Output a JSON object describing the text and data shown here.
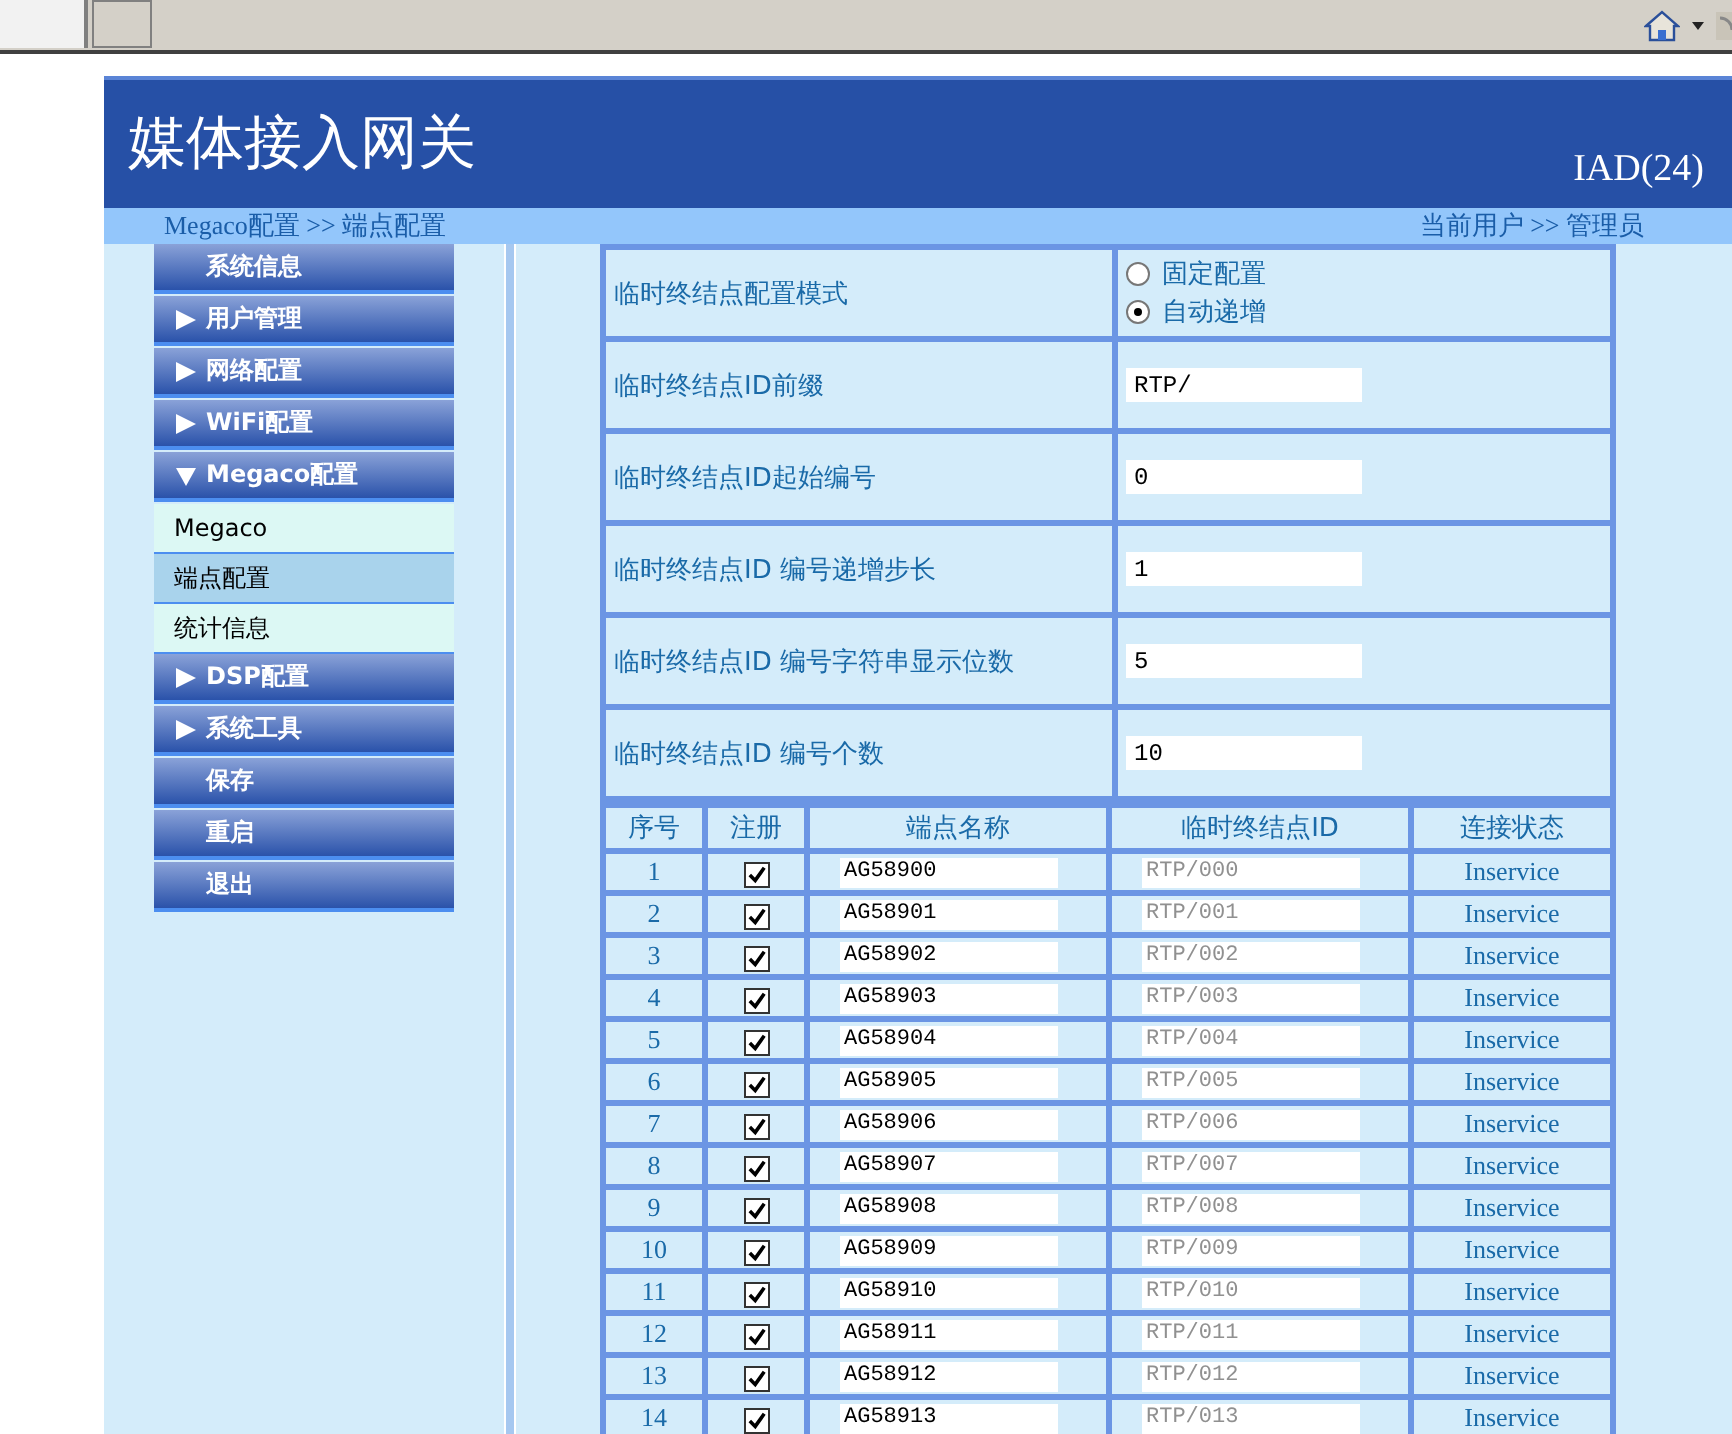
{
  "header": {
    "title": "媒体接入网关",
    "model": "IAD(24)"
  },
  "breadcrumb": {
    "path": "Megaco配置 >> 端点配置",
    "user": "当前用户 >> 管理员"
  },
  "sidebar": {
    "items": [
      {
        "label": "系统信息",
        "kind": "action"
      },
      {
        "label": "用户管理",
        "kind": "group",
        "expanded": false
      },
      {
        "label": "网络配置",
        "kind": "group",
        "expanded": false
      },
      {
        "label": "WiFi配置",
        "kind": "group",
        "expanded": false
      },
      {
        "label": "Megaco配置",
        "kind": "group",
        "expanded": true,
        "children": [
          {
            "label": "Megaco",
            "selected": false
          },
          {
            "label": "端点配置",
            "selected": true
          },
          {
            "label": "统计信息",
            "selected": false
          }
        ]
      },
      {
        "label": "DSP配置",
        "kind": "group",
        "expanded": false
      },
      {
        "label": "系统工具",
        "kind": "group",
        "expanded": false
      },
      {
        "label": "保存",
        "kind": "action"
      },
      {
        "label": "重启",
        "kind": "action"
      },
      {
        "label": "退出",
        "kind": "action"
      }
    ]
  },
  "form": {
    "rows": [
      {
        "label": "临时终结点配置模式",
        "kind": "radio",
        "options": [
          {
            "label": "固定配置",
            "selected": false
          },
          {
            "label": "自动递增",
            "selected": true
          }
        ]
      },
      {
        "label": "临时终结点ID前缀",
        "kind": "text",
        "value": "RTP/"
      },
      {
        "label": "临时终结点ID起始编号",
        "kind": "text",
        "value": "0"
      },
      {
        "label": "临时终结点ID 编号递增步长",
        "kind": "text",
        "value": "1"
      },
      {
        "label": "临时终结点ID 编号字符串显示位数",
        "kind": "text",
        "value": "5"
      },
      {
        "label": "临时终结点ID 编号个数",
        "kind": "text",
        "value": "10"
      }
    ]
  },
  "table": {
    "columns": [
      "序号",
      "注册",
      "端点名称",
      "临时终结点ID",
      "连接状态"
    ],
    "rows": [
      {
        "index": "1",
        "registered": true,
        "name": "AG58900",
        "id": "RTP/000",
        "status": "Inservice"
      },
      {
        "index": "2",
        "registered": true,
        "name": "AG58901",
        "id": "RTP/001",
        "status": "Inservice"
      },
      {
        "index": "3",
        "registered": true,
        "name": "AG58902",
        "id": "RTP/002",
        "status": "Inservice"
      },
      {
        "index": "4",
        "registered": true,
        "name": "AG58903",
        "id": "RTP/003",
        "status": "Inservice"
      },
      {
        "index": "5",
        "registered": true,
        "name": "AG58904",
        "id": "RTP/004",
        "status": "Inservice"
      },
      {
        "index": "6",
        "registered": true,
        "name": "AG58905",
        "id": "RTP/005",
        "status": "Inservice"
      },
      {
        "index": "7",
        "registered": true,
        "name": "AG58906",
        "id": "RTP/006",
        "status": "Inservice"
      },
      {
        "index": "8",
        "registered": true,
        "name": "AG58907",
        "id": "RTP/007",
        "status": "Inservice"
      },
      {
        "index": "9",
        "registered": true,
        "name": "AG58908",
        "id": "RTP/008",
        "status": "Inservice"
      },
      {
        "index": "10",
        "registered": true,
        "name": "AG58909",
        "id": "RTP/009",
        "status": "Inservice"
      },
      {
        "index": "11",
        "registered": true,
        "name": "AG58910",
        "id": "RTP/010",
        "status": "Inservice"
      },
      {
        "index": "12",
        "registered": true,
        "name": "AG58911",
        "id": "RTP/011",
        "status": "Inservice"
      },
      {
        "index": "13",
        "registered": true,
        "name": "AG58912",
        "id": "RTP/012",
        "status": "Inservice"
      },
      {
        "index": "14",
        "registered": true,
        "name": "AG58913",
        "id": "RTP/013",
        "status": "Inservice"
      }
    ]
  }
}
